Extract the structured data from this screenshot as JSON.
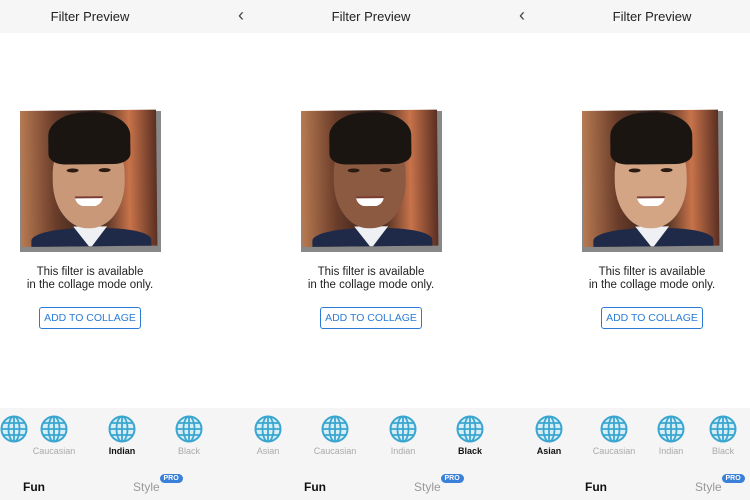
{
  "panels": [
    {
      "title": "Filter Preview",
      "has_back": false,
      "skin": "#c89878",
      "message_line1": "This filter is available",
      "message_line2": "in the collage mode only.",
      "button": "ADD TO COLLAGE",
      "selected": "Indian",
      "partial_left_icon": true,
      "filters": [
        {
          "label": ""
        },
        {
          "label": "Caucasian"
        },
        {
          "label": "Indian"
        },
        {
          "label": "Black"
        }
      ],
      "tabs": {
        "fun": "Fun",
        "style": "Style",
        "badge": "PRO"
      }
    },
    {
      "title": "Filter Preview",
      "has_back": true,
      "skin": "#8c5a40",
      "message_line1": "This filter is available",
      "message_line2": "in the collage mode only.",
      "button": "ADD TO COLLAGE",
      "selected": "Black",
      "filters": [
        {
          "label": "Asian"
        },
        {
          "label": "Caucasian"
        },
        {
          "label": "Indian"
        },
        {
          "label": "Black"
        }
      ],
      "tabs": {
        "fun": "Fun",
        "style": "Style",
        "badge": "PRO"
      }
    },
    {
      "title": "Filter Preview",
      "has_back": true,
      "skin": "#d4a585",
      "message_line1": "This filter is available",
      "message_line2": "in the collage mode only.",
      "button": "ADD TO COLLAGE",
      "selected": "Asian",
      "filters": [
        {
          "label": "Asian"
        },
        {
          "label": "Caucasian"
        },
        {
          "label": "Indian"
        },
        {
          "label": "Black"
        }
      ],
      "tabs": {
        "fun": "Fun",
        "style": "Style",
        "badge": "PRO"
      }
    }
  ],
  "icons": {
    "back": "chevron-left-icon",
    "filter": "globe-icon"
  },
  "colors": {
    "accent": "#2b7bd6",
    "badge": "#3a7fd8",
    "globe": "#3aa6d0"
  }
}
